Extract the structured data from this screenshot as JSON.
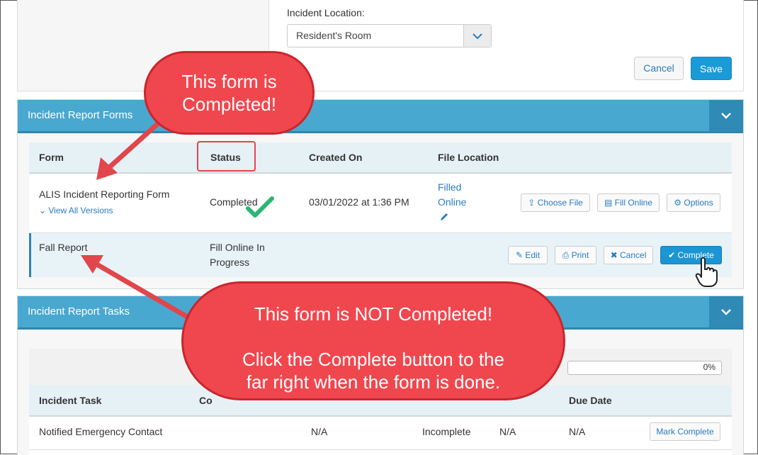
{
  "incident_location": {
    "label": "Incident Location:",
    "value": "Resident's Room"
  },
  "top_actions": {
    "cancel": "Cancel",
    "save": "Save"
  },
  "forms_section": {
    "title": "Incident Report Forms",
    "columns": [
      "Form",
      "Status",
      "Created On",
      "File Location"
    ],
    "rows": [
      {
        "form": "ALIS Incident Reporting Form",
        "versions_link": "View All Versions",
        "status": "Completed",
        "created_on": "03/01/2022 at 1:36 PM",
        "file_location_line1": "Filled",
        "file_location_line2": "Online",
        "buttons": [
          "Choose File",
          "Fill Online",
          "Options"
        ]
      },
      {
        "form": "Fall Report",
        "status_line1": "Fill Online In",
        "status_line2": "Progress",
        "buttons": [
          "Edit",
          "Print",
          "Cancel",
          "Complete"
        ]
      }
    ]
  },
  "tasks_section": {
    "title": "Incident Report Tasks",
    "progress_text": "0%",
    "progress_value": 0,
    "columns": [
      "Incident Task",
      "Co",
      "Due Date"
    ],
    "rows": [
      {
        "task": "Notified Emergency Contact",
        "col2": "N/A",
        "status": "Incomplete",
        "col4": "N/A",
        "due": "N/A",
        "button": "Mark Complete"
      }
    ]
  },
  "callouts": {
    "top_line1": "This form is",
    "top_line2": "Completed!",
    "bottom_line1": "This form is NOT Completed!",
    "bottom_line2": "Click the Complete button to the",
    "bottom_line3": "far right when the form is done."
  },
  "colors": {
    "header_blue": "#49a8cf",
    "button_blue": "#1a9bd7",
    "callout_red": "#f0474e",
    "check_green": "#2bb673"
  },
  "icons": [
    "chevron-down-icon",
    "upload-icon",
    "file-icon",
    "gear-icon",
    "pencil-icon",
    "printer-icon",
    "close-icon",
    "check-icon",
    "hand-pointer-icon",
    "checkmark-icon"
  ]
}
